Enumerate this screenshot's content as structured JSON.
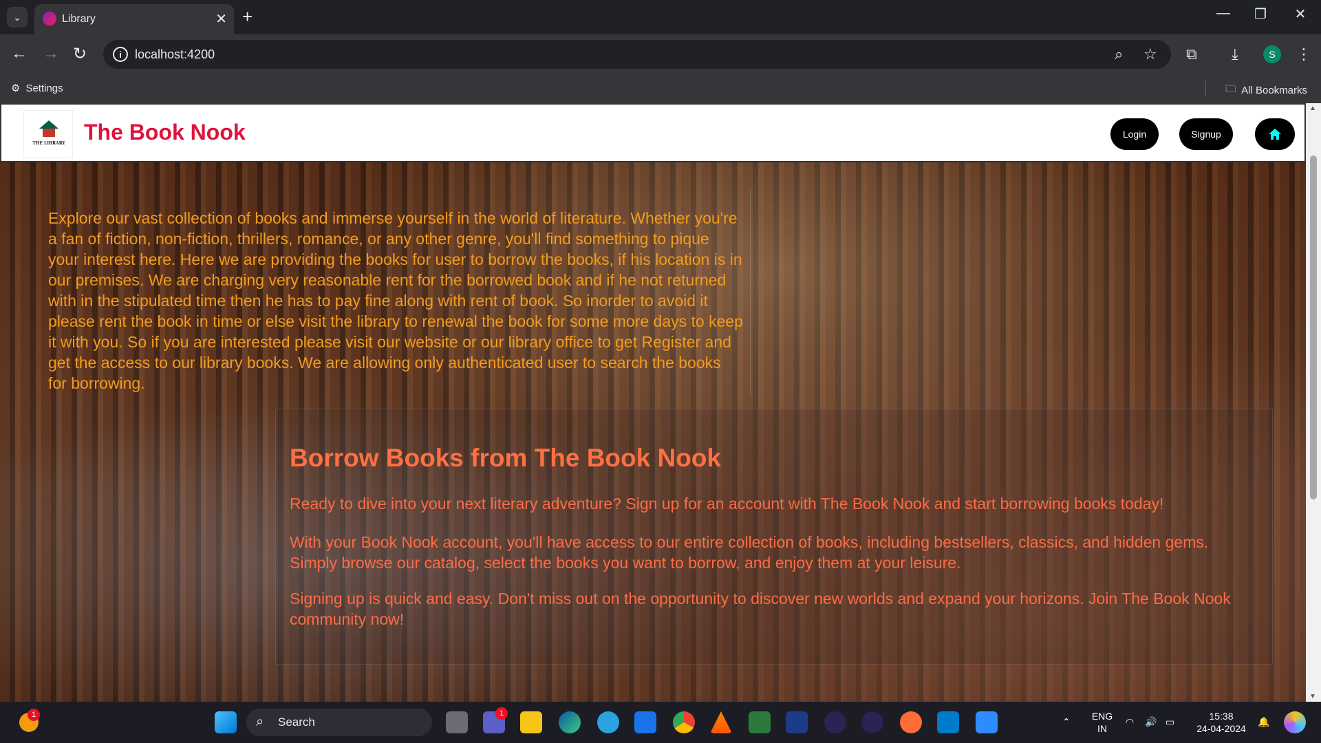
{
  "browser": {
    "tab_title": "Library",
    "url": "localhost:4200",
    "bookmarks": {
      "settings": "Settings",
      "all": "All Bookmarks"
    },
    "profile_initial": "S"
  },
  "site": {
    "title": "The Book Nook",
    "logo_text": "THE LIBRARY",
    "nav": {
      "login": "Login",
      "signup": "Signup"
    },
    "intro": "Explore our vast collection of books and immerse yourself in the world of literature. Whether you're a fan of fiction, non-fiction, thrillers, romance, or any other genre, you'll find something to pique your interest here. Here we are providing the books for user to borrow the books, if his location is in our premises. We are charging very reasonable rent for the borrowed book and if he not returned with in the stipulated time then he has to pay fine along with rent of book. So inorder to avoid it please rent the book in time or else visit the library to renewal the book for some more days to keep it with you. So if you are interested please visit our website or our library office to get Register and get the access to our library books. We are allowing only authenticated user to search the books for borrowing.",
    "card": {
      "title": "Borrow Books from The Book Nook",
      "p1": "Ready to dive into your next literary adventure? Sign up for an account with The Book Nook and start borrowing books today!",
      "p2": "With your Book Nook account, you'll have access to our entire collection of books, including bestsellers, classics, and hidden gems. Simply browse our catalog, select the books you want to borrow, and enjoy them at your leisure.",
      "p3": "Signing up is quick and easy. Don't miss out on the opportunity to discover new worlds and expand your horizons. Join The Book Nook community now!"
    },
    "colors": {
      "title": "#dc143c",
      "intro": "#f29c1f",
      "card_text": "#ff6b45"
    }
  },
  "taskbar": {
    "search_label": "Search",
    "lang_line1": "ENG",
    "lang_line2": "IN",
    "time": "15:38",
    "date": "24-04-2024",
    "notif_badge": "1",
    "teams_badge": "1"
  }
}
